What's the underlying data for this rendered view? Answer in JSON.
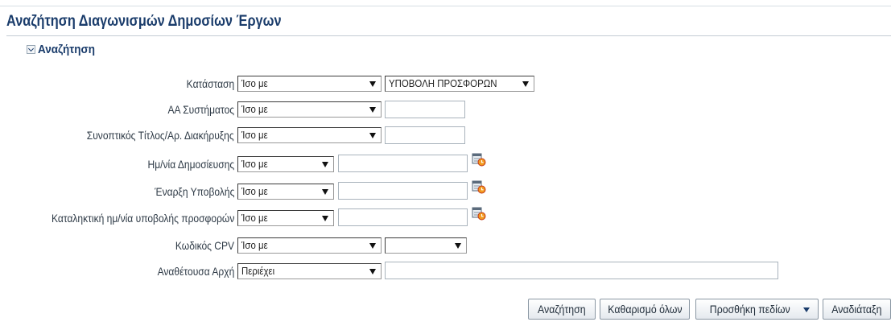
{
  "page": {
    "title": "Αναζήτηση Διαγωνισμών Δημοσίων Έργων"
  },
  "section": {
    "label": "Αναζήτηση"
  },
  "fields": [
    {
      "label": "Κατάσταση",
      "operator": "Ίσο με",
      "value": "ΥΠΟΒΟΛΗ ΠΡΟΣΦΟΡΩΝ"
    },
    {
      "label": "ΑΑ Συστήματος",
      "operator": "Ίσο με",
      "value": ""
    },
    {
      "label": "Συνοπτικός Τίτλος/Αρ. Διακήρυξης",
      "operator": "Ίσο με",
      "value": ""
    },
    {
      "label": "Ημ/νία Δημοσίευσης",
      "operator": "Ίσο με",
      "value": ""
    },
    {
      "label": "Έναρξη Υποβολής",
      "operator": "Ίσο με",
      "value": ""
    },
    {
      "label": "Καταληκτική ημ/νία υποβολής προσφορών",
      "operator": "Ίσο με",
      "value": ""
    },
    {
      "label": "Κωδικός CPV",
      "operator": "Ίσο με",
      "value": ""
    },
    {
      "label": "Αναθέτουσα Αρχή",
      "operator": "Περιέχει",
      "value": ""
    }
  ],
  "icons": {
    "date_picker": "calendar-clock-icon",
    "section_toggle": "chevron-down-icon"
  },
  "buttons": {
    "search": "Αναζήτηση",
    "clear_all": "Καθαρισμό όλων",
    "add_fields": "Προσθήκη πεδίων",
    "reorder": "Αναδιάταξη"
  }
}
